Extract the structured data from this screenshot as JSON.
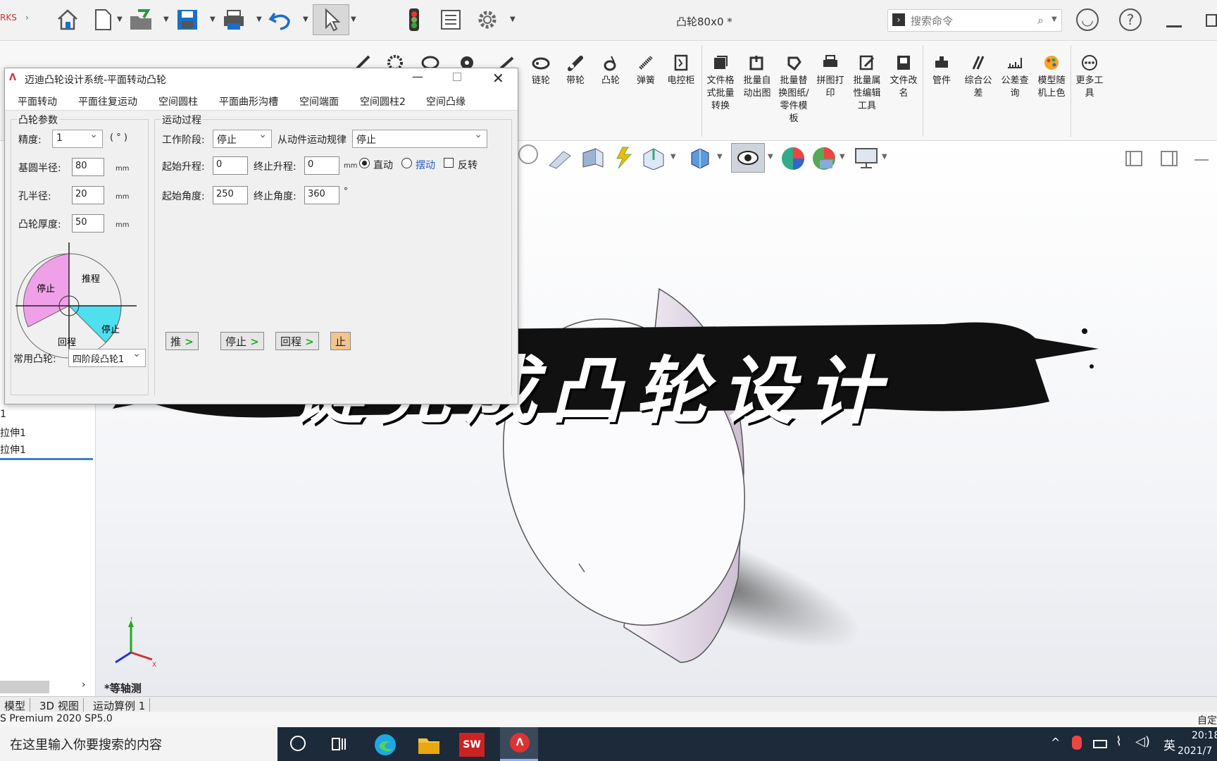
{
  "header": {
    "brand_fragment": "RKS",
    "document_title": "凸轮80x0 *",
    "search_placeholder": "搜索命令"
  },
  "ribbon": {
    "items": [
      {
        "label": "链轮",
        "icon": "chain-wheel-icon"
      },
      {
        "label": "带轮",
        "icon": "belt-pulley-icon"
      },
      {
        "label": "凸轮",
        "icon": "cam-icon"
      },
      {
        "label": "弹簧",
        "icon": "spring-icon"
      },
      {
        "label": "电控柜",
        "icon": "control-cabinet-icon"
      },
      {
        "label": "文件格式批量转换",
        "icon": "batch-convert-icon"
      },
      {
        "label": "批量自动出图",
        "icon": "batch-drawing-icon"
      },
      {
        "label": "批量替换图纸/零件模板",
        "icon": "batch-replace-icon"
      },
      {
        "label": "拼图打印",
        "icon": "print-icon"
      },
      {
        "label": "批量属性编辑工具",
        "icon": "batch-edit-icon"
      },
      {
        "label": "文件改名",
        "icon": "rename-icon"
      },
      {
        "label": "管件",
        "icon": "pipe-fitting-icon"
      },
      {
        "label": "综合公差",
        "icon": "tolerance-icon"
      },
      {
        "label": "公差查询",
        "icon": "tolerance-query-icon"
      },
      {
        "label": "模型随机上色",
        "icon": "palette-icon"
      },
      {
        "label": "更多工具",
        "icon": "more-icon"
      }
    ]
  },
  "dialog": {
    "title": "迈迪凸轮设计系统-平面转动凸轮",
    "menu": [
      "平面转动",
      "平面往复运动",
      "空间圆柱",
      "平面曲形沟槽",
      "空间端面",
      "空间圆柱2",
      "空间凸缘"
    ],
    "params_group": "凸轮参数",
    "precision_label": "精度:",
    "precision_value": "1",
    "precision_unit": "( ° )",
    "base_radius_label": "基圆半径:",
    "base_radius_value": "80",
    "hole_radius_label": "孔半径:",
    "hole_radius_value": "20",
    "thickness_label": "凸轮厚度:",
    "thickness_value": "50",
    "unit_mm": "mm",
    "diagram": {
      "stop1": "停止",
      "push": "推程",
      "stop2": "停止",
      "return": "回程"
    },
    "common_label": "常用凸轮:",
    "common_value": "四阶段凸轮1",
    "motion_group": "运动过程",
    "stage_label": "工作阶段:",
    "stage_value": "停止",
    "law_label": "从动件运动规律",
    "law_value": "停止",
    "start_lift_label": "起始升程:",
    "start_lift_value": "0",
    "end_lift_label": "终止升程:",
    "end_lift_value": "0",
    "start_angle_label": "起始角度:",
    "start_angle_value": "250",
    "end_angle_label": "终止角度:",
    "end_angle_value": "360",
    "degree": "°",
    "radio_direct": "直动",
    "radio_swing": "摆动",
    "check_reverse": "反转",
    "steps": [
      "推",
      "停止",
      "回程",
      "止"
    ]
  },
  "left_panel": {
    "items": [
      "1",
      "拉伸1",
      "拉伸1"
    ]
  },
  "viewport": {
    "view_label": "*等轴测",
    "axes": {
      "x": "X",
      "y": "Y",
      "z": "Z"
    }
  },
  "banner": {
    "text": "一键完成凸轮设计"
  },
  "bottom_tabs": [
    "模型",
    "3D 视图",
    "运动算例 1"
  ],
  "status": {
    "left": "S Premium 2020 SP5.0",
    "right": "自定"
  },
  "taskbar": {
    "search_placeholder": "在这里输入你要搜索的内容",
    "ime": "英",
    "time": "20:18",
    "date": "2021/7"
  }
}
